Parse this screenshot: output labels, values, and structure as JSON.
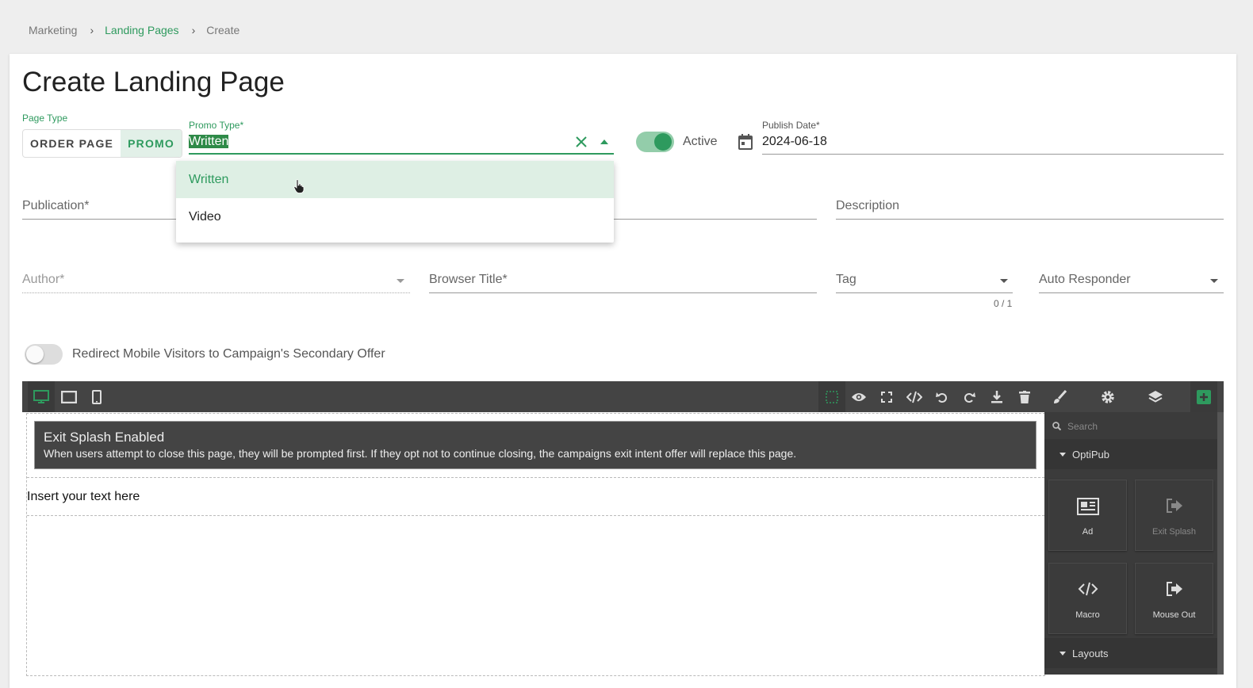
{
  "breadcrumb": {
    "items": [
      "Marketing",
      "Landing Pages",
      "Create"
    ],
    "separator": "›"
  },
  "page": {
    "title": "Create Landing Page"
  },
  "page_type": {
    "label": "Page Type",
    "options": [
      "ORDER PAGE",
      "PROMO"
    ],
    "selected": "PROMO"
  },
  "promo_type": {
    "label": "Promo Type*",
    "value": "Written",
    "options": [
      "Written",
      "Video"
    ]
  },
  "active_toggle": {
    "label": "Active",
    "on": true
  },
  "publish_date": {
    "label": "Publish Date*",
    "value": "2024-06-18"
  },
  "fields": {
    "publication": "Publication*",
    "description": "Description",
    "author": "Author*",
    "browser_title": "Browser Title*",
    "tag": "Tag",
    "tag_counter": "0 / 1",
    "auto_responder": "Auto Responder"
  },
  "redirect_toggle": {
    "label": "Redirect Mobile Visitors to Campaign's Secondary Offer",
    "on": false
  },
  "editor": {
    "splash_title": "Exit Splash Enabled",
    "splash_text": "When users attempt to close this page, they will be prompted first. If they opt not to continue closing, the campaigns exit intent offer will replace this page.",
    "text_block": "Insert your text here",
    "search_placeholder": "Search",
    "sections": [
      "OptiPub",
      "Layouts"
    ],
    "blocks": [
      "Ad",
      "Exit Splash",
      "Macro",
      "Mouse Out"
    ]
  },
  "colors": {
    "accent": "#2e9a5e",
    "toolbar": "#444444",
    "panel": "#3b3b3b"
  }
}
